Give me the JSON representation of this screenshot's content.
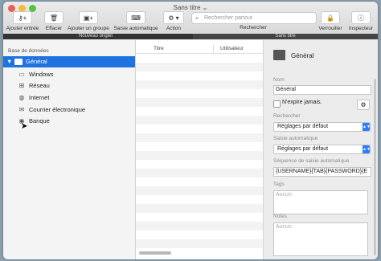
{
  "window": {
    "title": "Sans titre ⌄"
  },
  "toolbar": {
    "add_entry": "Ajouter entrée",
    "delete": "Effacer",
    "add_group": "Ajouter un groupe",
    "autotype": "Saisie automatique",
    "action": "Action",
    "search_placeholder": "Rechercher partout",
    "search_label": "Rechercher",
    "lock": "Verrouiller",
    "inspector": "Inspecteur"
  },
  "tabs": [
    "Nouveau onglet",
    "Sans titre"
  ],
  "sidebar": {
    "heading": "Base de données",
    "root": "Général",
    "items": [
      {
        "label": "Windows",
        "icon": "windows-icon"
      },
      {
        "label": "Réseau",
        "icon": "network-icon"
      },
      {
        "label": "Internet",
        "icon": "globe-icon"
      },
      {
        "label": "Courrier électronique",
        "icon": "mail-icon"
      },
      {
        "label": "Banque",
        "icon": "bank-icon"
      }
    ]
  },
  "list": {
    "columns": [
      "Titre",
      "Utilisateur"
    ]
  },
  "inspector": {
    "title": "Général",
    "name_label": "Nom",
    "name_value": "Général",
    "expires_label": "N'expire jamais.",
    "search_label": "Rechercher",
    "search_value": "Réglages par défaut",
    "autotype_label": "Saisie automatique",
    "autotype_value": "Réglages par défaut",
    "sequence_label": "Séquence de saisie automatique",
    "sequence_value": "{USERNAME}{TAB}{PASSWORD}{E",
    "tags_label": "Tags",
    "tags_placeholder": "Aucun",
    "notes_label": "Notes",
    "notes_placeholder": "Aucun"
  },
  "colors": {
    "selection": "#1f73e0",
    "popup_accent": "#2f7df6"
  }
}
